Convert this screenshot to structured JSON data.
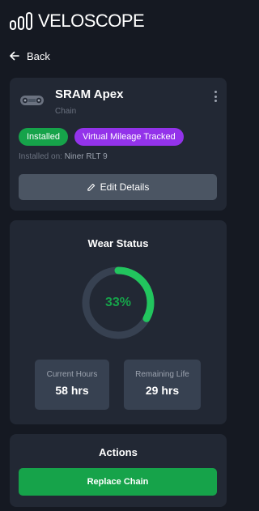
{
  "app": {
    "name": "VELOSCOPE",
    "logo_icon": "velocity-bars-logo-icon"
  },
  "nav": {
    "back_label": "Back",
    "back_icon": "arrow-left-icon"
  },
  "part": {
    "name": "SRAM Apex",
    "type": "Chain",
    "icon": "chain-icon",
    "menu_icon": "kebab-menu-icon",
    "badges": [
      {
        "label": "Installed",
        "color": "#16a34a"
      },
      {
        "label": "Virtual Mileage Tracked",
        "color": "#9333ea"
      }
    ],
    "installed_on_label": "Installed on:",
    "installed_on_value": "Niner RLT 9",
    "edit_label": "Edit Details",
    "edit_icon": "pencil-icon"
  },
  "wear": {
    "title": "Wear Status",
    "percent_label": "33%",
    "percent_value": 0.33,
    "accent": "#22c55e",
    "stats": [
      {
        "label": "Current Hours",
        "value": "58 hrs"
      },
      {
        "label": "Remaining Life",
        "value": "29 hrs"
      }
    ]
  },
  "actions": {
    "title": "Actions",
    "replace_label": "Replace Chain"
  },
  "colors": {
    "background": "#151922",
    "card": "#222834",
    "success": "#16a34a",
    "purple": "#9333ea"
  }
}
